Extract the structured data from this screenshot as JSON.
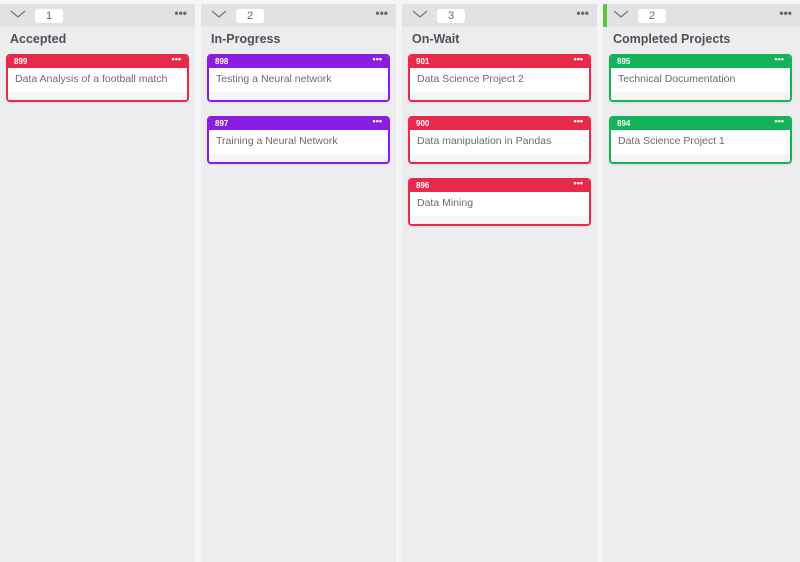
{
  "colors": {
    "red": "#e8294a",
    "purple": "#8a1de0",
    "green": "#13b35a",
    "accent_green": "#5cc93a"
  },
  "columns": [
    {
      "title": "Accepted",
      "count": "1",
      "menu": "•••",
      "color": "red",
      "cards": [
        {
          "id": "899",
          "title": "Data Analysis of a football match",
          "menu": "•••"
        }
      ]
    },
    {
      "title": "In-Progress",
      "count": "2",
      "menu": "•••",
      "color": "purple",
      "cards": [
        {
          "id": "898",
          "title": "Testing a Neural network",
          "menu": "•••"
        },
        {
          "id": "897",
          "title": "Training a Neural Network",
          "menu": "•••"
        }
      ]
    },
    {
      "title": "On-Wait",
      "count": "3",
      "menu": "•••",
      "color": "red",
      "cards": [
        {
          "id": "901",
          "title": "Data Science Project 2",
          "menu": "•••"
        },
        {
          "id": "900",
          "title": "Data manipulation in Pandas",
          "menu": "•••"
        },
        {
          "id": "896",
          "title": "Data Mining",
          "menu": "•••"
        }
      ]
    },
    {
      "title": "Completed Projects",
      "count": "2",
      "menu": "•••",
      "color": "green",
      "accent": true,
      "cards": [
        {
          "id": "895",
          "title": "Technical Documentation",
          "menu": "•••"
        },
        {
          "id": "894",
          "title": "Data Science Project 1",
          "menu": "•••"
        }
      ]
    }
  ]
}
